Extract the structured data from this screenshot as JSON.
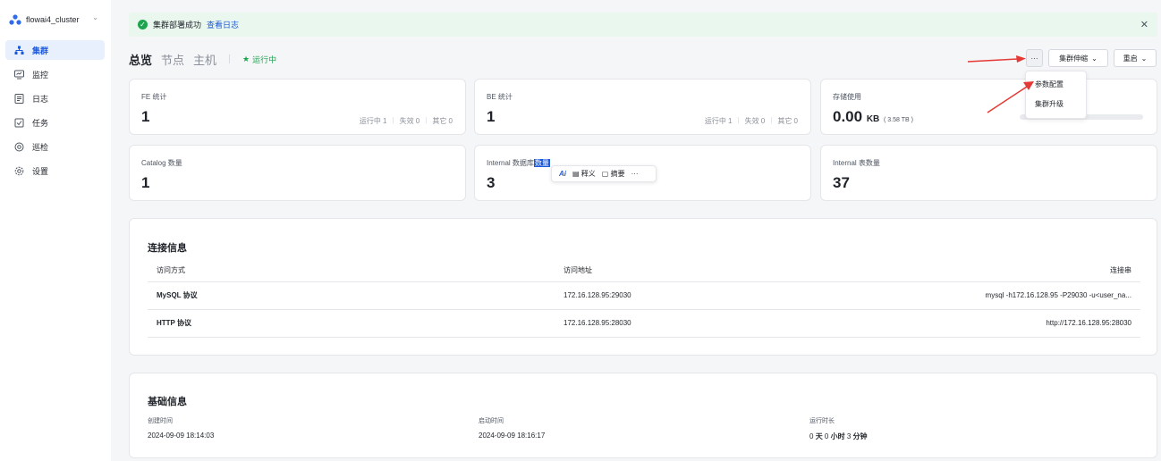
{
  "sidebar": {
    "cluster_name": "flowai4_cluster",
    "items": [
      {
        "label": "集群",
        "icon": "cluster-icon",
        "active": true
      },
      {
        "label": "监控",
        "icon": "monitor-icon"
      },
      {
        "label": "日志",
        "icon": "log-icon"
      },
      {
        "label": "任务",
        "icon": "task-icon"
      },
      {
        "label": "巡检",
        "icon": "inspect-icon"
      },
      {
        "label": "设置",
        "icon": "gear-icon"
      }
    ]
  },
  "alert": {
    "message": "集群部署成功",
    "link": "查看日志"
  },
  "tabs": [
    "总览",
    "节点",
    "主机"
  ],
  "status": "运行中",
  "toolbar": {
    "more": "···",
    "scale": "集群伸缩",
    "restart": "重启"
  },
  "dropdown": [
    "参数配置",
    "集群升级"
  ],
  "cards": {
    "fe": {
      "title": "FE 统计",
      "value": "1",
      "running": "运行中 1",
      "failed": "失效 0",
      "other": "其它 0"
    },
    "be": {
      "title": "BE 统计",
      "value": "1",
      "running": "运行中 1",
      "failed": "失效 0",
      "other": "其它 0"
    },
    "storage": {
      "title": "存储使用",
      "value": "0.00",
      "unit": "KB",
      "total": "( 3.58 TB )",
      "usage_fraction": 0
    },
    "catalog": {
      "title": "Catalog 数量",
      "value": "1"
    },
    "internal_db": {
      "title_prefix": "Internal 数据库",
      "title_selected": "数量",
      "value": "3"
    },
    "internal_table": {
      "title": "Internal 表数量",
      "value": "37"
    }
  },
  "ai_popup": {
    "ai": "Ai",
    "explain": "释义",
    "summary": "摘要",
    "more": "···"
  },
  "connection": {
    "title": "连接信息",
    "headers": [
      "访问方式",
      "访问地址",
      "连接串"
    ],
    "rows": [
      [
        "MySQL 协议",
        "172.16.128.95:29030",
        "mysql -h172.16.128.95 -P29030 -u<user_na..."
      ],
      [
        "HTTP 协议",
        "172.16.128.95:28030",
        "http://172.16.128.95:28030"
      ]
    ]
  },
  "basic": {
    "title": "基础信息",
    "created_label": "创建时间",
    "created": "2024-09-09 18:14:03",
    "started_label": "启动时间",
    "started": "2024-09-09 18:16:17",
    "uptime_label": "运行时长",
    "uptime_days": "0",
    "uptime_d": "天",
    "uptime_hours": "0",
    "uptime_h": "小时",
    "uptime_minutes": "3",
    "uptime_m": "分钟"
  },
  "colors": {
    "accent": "#1d58d8",
    "success": "#1ca44f",
    "annotation": "#e53935"
  }
}
